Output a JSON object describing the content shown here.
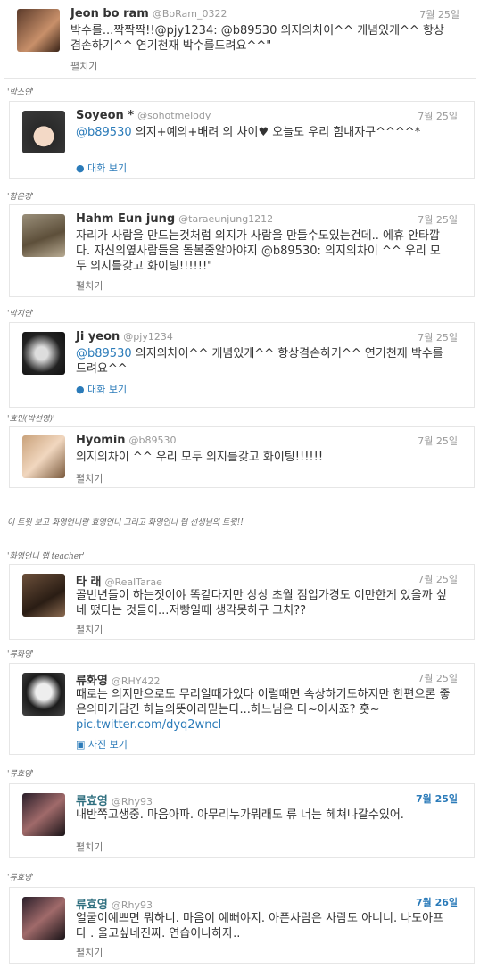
{
  "tweets": [
    {
      "name": "Jeon bo ram",
      "handle": "@BoRam_0322",
      "time": "7월 25일",
      "body": "박수를...짝짝짝!!@pjy1234: @b89530 의지의차이^^ 개념있게^^ 항상겸손하기^^ 연기천재 박수를드려요^^\"",
      "action": "펼치기"
    },
    {
      "name": "Soyeon *",
      "handle": "@sohotmelody",
      "time": "7월 25일",
      "mention": "@b89530",
      "body": "의지+예의+배려 의 차이♥ 오늘도 우리 힘내자구^^^^*",
      "action": "대화 보기"
    },
    {
      "name": "Hahm Eun jung",
      "handle": "@taraeunjung1212",
      "time": "7월 25일",
      "body": "자리가 사람을 만드는것처럼 의지가 사람을 만들수도있는건데.. 에휴 안타깝다. 자신의옆사람들을 돌볼줄알아야지 @b89530: 의지의차이 ^^ 우리 모두 의지를갖고 화이팅!!!!!!\"",
      "action": "펼치기"
    },
    {
      "name": "Ji yeon",
      "handle": "@pjy1234",
      "time": "7월 25일",
      "mention": "@b89530",
      "body": "의지의차이^^ 개념있게^^ 항상겸손하기^^ 연기천재 박수를드려요^^",
      "action": "대화 보기"
    },
    {
      "name": "Hyomin",
      "handle": "@b89530",
      "time": "7월 25일",
      "body": "의지의차이 ^^ 우리 모두 의지를갖고 화이팅!!!!!!",
      "action": "펼치기"
    },
    {
      "name": "타 래",
      "handle": "@RealTarae",
      "time": "7월 25일",
      "body": "골빈년들이 하는짓이야 똑같다지만 상상 초월 점입가경도 이만한게 있을까 싶네 떴다는 것들이...저빵일때 생각못하구 그치??",
      "action": "펼치기"
    },
    {
      "name": "류화영",
      "handle": "@RHY422",
      "time": "7월 25일",
      "body": "때로는 의지만으로도 무리일때가있다 이럴때면 속상하기도하지만 한편으론 좋은의미가담긴 하늘의뜻이라믿는다...하느님은 다~아시죠? 훗~",
      "link": "pic.twitter.com/dyq2wncl",
      "action": "사진 보기"
    },
    {
      "name": "류효영",
      "handle": "@Rhy93",
      "time": "7월 25일",
      "body": "내반쪽고생중. 마음아파. 아무리누가뭐래도 류 너는 헤쳐나갈수있어.",
      "action": "펼치기"
    },
    {
      "name": "류효영",
      "handle": "@Rhy93",
      "time": "7월 26일",
      "body": "얼굴이예쁘면 뭐하니. 마음이 예뻐야지. 아픈사람은 사람도 아니니. 나도아프다 . 울고싶네진짜. 연습이나하자..",
      "action": "펼치기"
    }
  ],
  "notes": [
    "'박소연'",
    "'함은정'",
    "'박지연'",
    "'효민(박선영)'",
    "이 트윗 보고 화영언니랑 효영언니 그리고 화영언니 랩 선생님의 트윗!!",
    "'화영언니 랩 teacher'",
    "'류화영'",
    "'류효영'",
    "'류효영'"
  ],
  "colors": {
    "mention": "#2b7bb9",
    "name_teal": "#2f6f7f",
    "border": "#e6e6e6",
    "muted": "#999999"
  }
}
